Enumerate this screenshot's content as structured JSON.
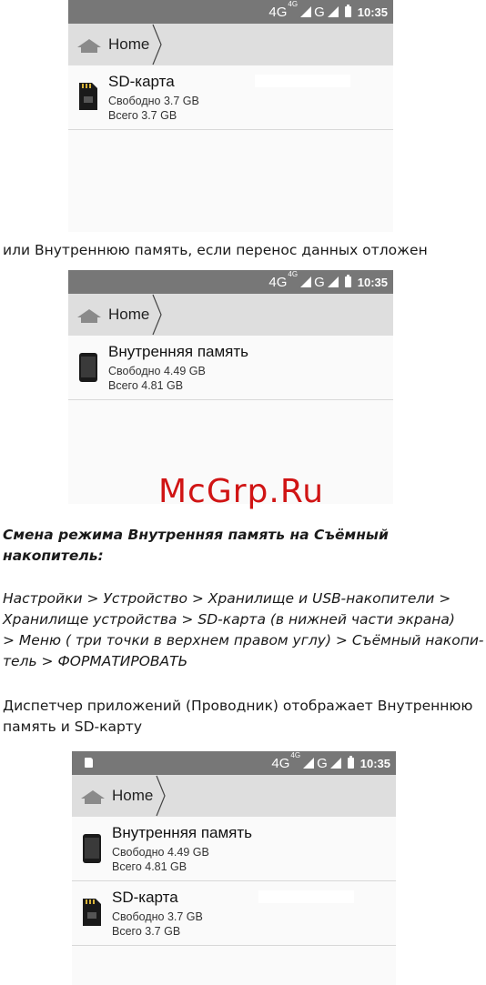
{
  "status": {
    "net1": "4G",
    "net1_sup": "4G",
    "net2": "G",
    "time": "10:35"
  },
  "breadcrumb": {
    "home": "Home"
  },
  "storage": {
    "sd": {
      "name": "SD-карта",
      "free": "Свободно 3.7 GB",
      "total": "Всего 3.7 GB"
    },
    "internal": {
      "name": "Внутренняя память",
      "free": "Свободно 4.49 GB",
      "total": "Всего 4.81 GB"
    }
  },
  "text": {
    "or_internal": "или Внутреннюю память, если перенос данных отложен",
    "heading_line1": "Смена режима Внутренняя память на Съёмный",
    "heading_line2": "накопитель:",
    "path_line1": "Настройки > Устройство > Хранилище и USB-накопители >",
    "path_line2": "Хранилище устройства  > SD-карта  (в нижней части экрана)",
    "path_line3": "> Меню ( три точки в верхнем правом углу) > Съёмный накопи-",
    "path_line4": "тель > ФОРМАТИРОВАТЬ",
    "explorer_line1": "Диспетчер приложений (Проводник) отображает Внутреннюю",
    "explorer_line2": "память и SD-карту"
  },
  "watermark": "McGrp.Ru",
  "colors": {
    "statusbar": "#777777",
    "breadcrumb": "#dedede",
    "watermark": "#d01414"
  }
}
